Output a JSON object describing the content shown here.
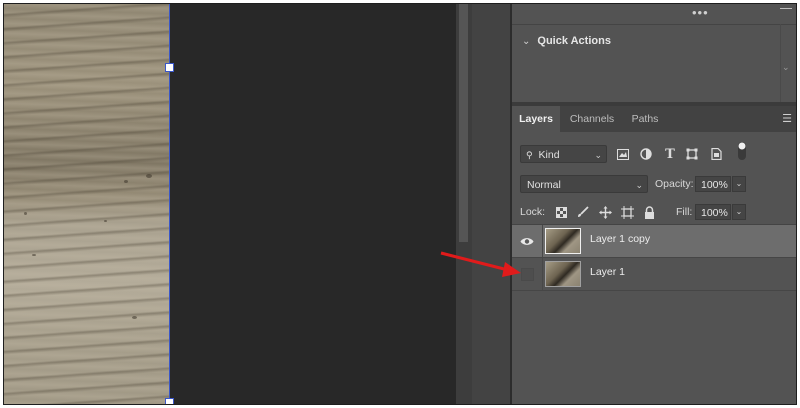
{
  "quick_actions": {
    "more_label": "•••",
    "title": "Quick Actions",
    "expand_glyph": "⌄"
  },
  "tabs": [
    {
      "label": "Layers",
      "active": true
    },
    {
      "label": "Channels",
      "active": false
    },
    {
      "label": "Paths",
      "active": false
    }
  ],
  "filter": {
    "search_glyph": "🔍",
    "kind_label": "Kind",
    "filter_icons": [
      "pixel-filter-icon",
      "adjustment-filter-icon",
      "type-filter-icon",
      "shape-filter-icon",
      "smart-object-filter-icon",
      "filter-toggle-icon"
    ]
  },
  "blend": {
    "mode": "Normal",
    "opacity_label": "Opacity:",
    "opacity_value": "100%"
  },
  "lock": {
    "label": "Lock:",
    "fill_label": "Fill:",
    "fill_value": "100%",
    "lock_icons": [
      "lock-transparent-pixels-icon",
      "lock-image-pixels-icon",
      "lock-position-icon",
      "lock-artboard-icon",
      "lock-all-icon"
    ]
  },
  "layers": [
    {
      "name": "Layer 1 copy",
      "visible": true,
      "selected": true
    },
    {
      "name": "Layer 1",
      "visible": false,
      "selected": false
    }
  ],
  "colors": {
    "accent_selection": "#3a57c9",
    "annotation_arrow": "#e11b1b",
    "panel_bg": "#535353",
    "selected_layer": "#6d6d6d"
  }
}
